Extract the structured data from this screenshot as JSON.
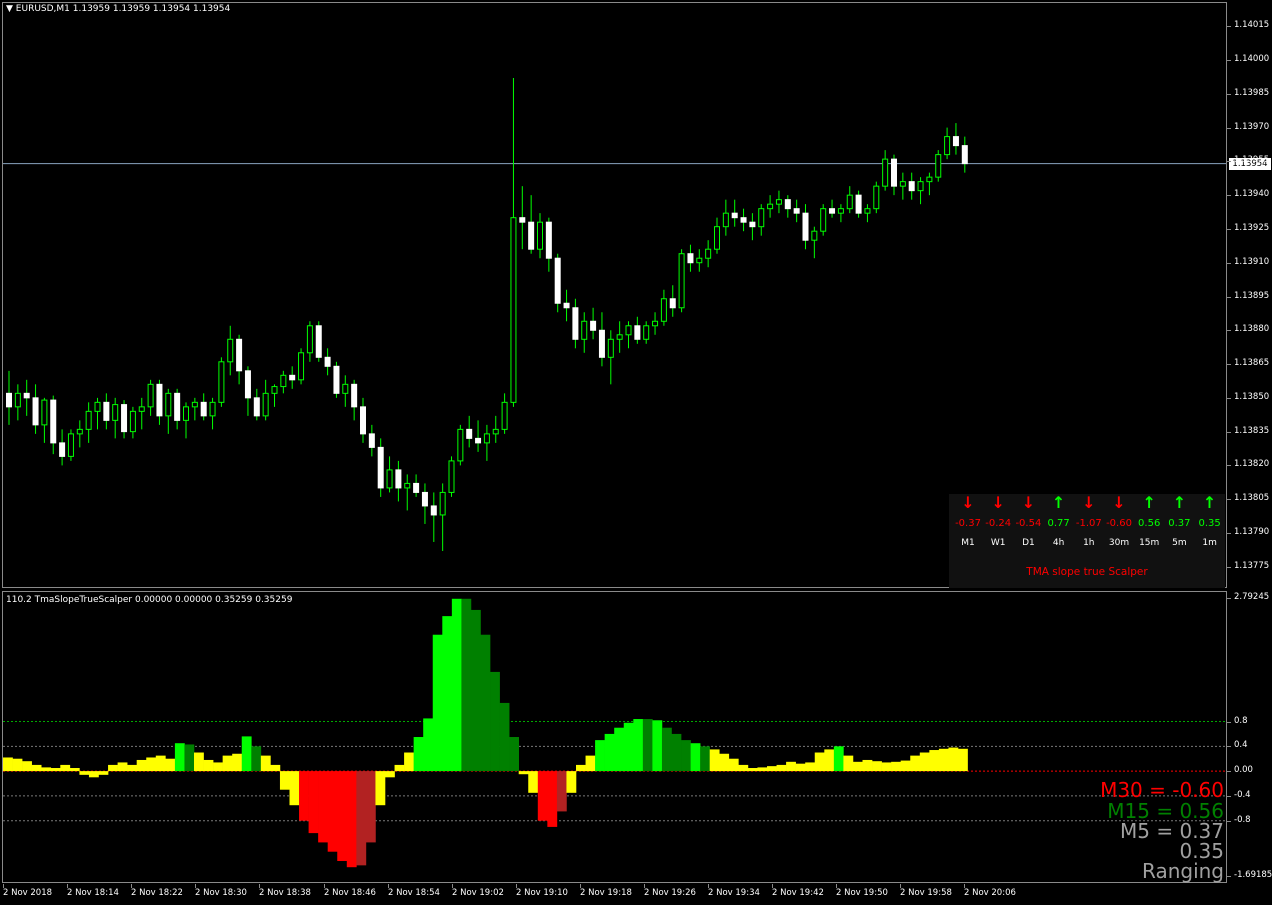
{
  "main_chart": {
    "title": "EURUSD,M1  1.13959 1.13959 1.13954 1.13954",
    "current_price": "1.13954",
    "price_ticks": [
      "1.14015",
      "1.14000",
      "1.13985",
      "1.13970",
      "1.13955",
      "1.13940",
      "1.13925",
      "1.13910",
      "1.13895",
      "1.13880",
      "1.13865",
      "1.13850",
      "1.13835",
      "1.13820",
      "1.13805",
      "1.13790",
      "1.13775"
    ]
  },
  "indicator": {
    "title": "110.2 TmaSlopeTrueScalper 0.00000 0.00000 0.35259 0.35259",
    "ticks": [
      "2.79245",
      "0.8",
      "0.4",
      "0.00",
      "-0.4",
      "-0.8",
      "-1.69185"
    ],
    "readouts": [
      {
        "text": "M30 = -0.60",
        "color": "#ff0000"
      },
      {
        "text": "M15 = 0.56",
        "color": "#008000"
      },
      {
        "text": "M5 = 0.37",
        "color": "#a0a0a0"
      },
      {
        "text": "0.35",
        "color": "#a0a0a0"
      },
      {
        "text": "Ranging",
        "color": "#a0a0a0"
      }
    ]
  },
  "tma_panel": {
    "title": "TMA slope true Scalper",
    "timeframes": [
      {
        "label": "M1",
        "value": "-0.37",
        "dir": "down"
      },
      {
        "label": "W1",
        "value": "-0.24",
        "dir": "down"
      },
      {
        "label": "D1",
        "value": "-0.54",
        "dir": "down"
      },
      {
        "label": "4h",
        "value": "0.77",
        "dir": "up"
      },
      {
        "label": "1h",
        "value": "-1.07",
        "dir": "down"
      },
      {
        "label": "30m",
        "value": "-0.60",
        "dir": "down"
      },
      {
        "label": "15m",
        "value": "0.56",
        "dir": "up"
      },
      {
        "label": "5m",
        "value": "0.37",
        "dir": "up"
      },
      {
        "label": "1m",
        "value": "0.35",
        "dir": "up"
      }
    ],
    "colors": {
      "up": "#00ff00",
      "down": "#ff0000"
    }
  },
  "time_axis": [
    "2 Nov 2018",
    "2 Nov 18:14",
    "2 Nov 18:22",
    "2 Nov 18:30",
    "2 Nov 18:38",
    "2 Nov 18:46",
    "2 Nov 18:54",
    "2 Nov 19:02",
    "2 Nov 19:10",
    "2 Nov 19:18",
    "2 Nov 19:26",
    "2 Nov 19:34",
    "2 Nov 19:42",
    "2 Nov 19:50",
    "2 Nov 19:58",
    "2 Nov 20:06"
  ],
  "chart_data": {
    "type": "candlestick+histogram",
    "candles_ohlc": [
      [
        1.13852,
        1.13862,
        1.13838,
        1.13846
      ],
      [
        1.13846,
        1.13856,
        1.1384,
        1.13852
      ],
      [
        1.13852,
        1.13858,
        1.13842,
        1.1385
      ],
      [
        1.1385,
        1.13856,
        1.13834,
        1.13838
      ],
      [
        1.13838,
        1.1385,
        1.1383,
        1.13849
      ],
      [
        1.13849,
        1.13851,
        1.13825,
        1.1383
      ],
      [
        1.1383,
        1.13836,
        1.1382,
        1.13824
      ],
      [
        1.13824,
        1.13836,
        1.13822,
        1.13834
      ],
      [
        1.13834,
        1.1384,
        1.13828,
        1.13836
      ],
      [
        1.13836,
        1.13848,
        1.1383,
        1.13844
      ],
      [
        1.13844,
        1.1385,
        1.13836,
        1.13848
      ],
      [
        1.13848,
        1.13852,
        1.13836,
        1.1384
      ],
      [
        1.1384,
        1.1385,
        1.13832,
        1.13847
      ],
      [
        1.13847,
        1.13849,
        1.13832,
        1.13835
      ],
      [
        1.13835,
        1.13846,
        1.13832,
        1.13844
      ],
      [
        1.13844,
        1.1385,
        1.13836,
        1.13846
      ],
      [
        1.13846,
        1.13858,
        1.13842,
        1.13856
      ],
      [
        1.13856,
        1.13858,
        1.13838,
        1.13842
      ],
      [
        1.13842,
        1.13854,
        1.13834,
        1.13852
      ],
      [
        1.13852,
        1.13854,
        1.13836,
        1.1384
      ],
      [
        1.1384,
        1.13848,
        1.13832,
        1.13846
      ],
      [
        1.13846,
        1.1385,
        1.1384,
        1.13848
      ],
      [
        1.13848,
        1.13852,
        1.1384,
        1.13842
      ],
      [
        1.13842,
        1.1385,
        1.13836,
        1.13848
      ],
      [
        1.13848,
        1.13868,
        1.13846,
        1.13866
      ],
      [
        1.13866,
        1.13882,
        1.1386,
        1.13876
      ],
      [
        1.13876,
        1.13878,
        1.13856,
        1.13862
      ],
      [
        1.13862,
        1.13864,
        1.13842,
        1.1385
      ],
      [
        1.1385,
        1.13854,
        1.1384,
        1.13842
      ],
      [
        1.13842,
        1.13858,
        1.1384,
        1.13852
      ],
      [
        1.13852,
        1.13856,
        1.13846,
        1.13855
      ],
      [
        1.13855,
        1.13862,
        1.13852,
        1.1386
      ],
      [
        1.1386,
        1.13864,
        1.13854,
        1.13858
      ],
      [
        1.13858,
        1.13872,
        1.13856,
        1.1387
      ],
      [
        1.1387,
        1.13884,
        1.13866,
        1.13882
      ],
      [
        1.13882,
        1.13884,
        1.13866,
        1.13868
      ],
      [
        1.13868,
        1.13872,
        1.1386,
        1.13864
      ],
      [
        1.13864,
        1.13866,
        1.1385,
        1.13852
      ],
      [
        1.13852,
        1.1386,
        1.13846,
        1.13856
      ],
      [
        1.13856,
        1.13858,
        1.1384,
        1.13846
      ],
      [
        1.13846,
        1.1385,
        1.1383,
        1.13834
      ],
      [
        1.13834,
        1.13838,
        1.13824,
        1.13828
      ],
      [
        1.13828,
        1.13832,
        1.13806,
        1.1381
      ],
      [
        1.1381,
        1.13824,
        1.13808,
        1.13818
      ],
      [
        1.13818,
        1.13822,
        1.13804,
        1.1381
      ],
      [
        1.1381,
        1.13816,
        1.138,
        1.13812
      ],
      [
        1.13812,
        1.13816,
        1.13806,
        1.13808
      ],
      [
        1.13808,
        1.13812,
        1.13794,
        1.13802
      ],
      [
        1.13802,
        1.13808,
        1.13786,
        1.13798
      ],
      [
        1.13798,
        1.13812,
        1.13782,
        1.13808
      ],
      [
        1.13808,
        1.13824,
        1.13806,
        1.13822
      ],
      [
        1.13822,
        1.13838,
        1.1382,
        1.13836
      ],
      [
        1.13836,
        1.13842,
        1.13828,
        1.13832
      ],
      [
        1.13832,
        1.1384,
        1.13826,
        1.1383
      ],
      [
        1.1383,
        1.13838,
        1.13822,
        1.13834
      ],
      [
        1.13834,
        1.13842,
        1.1383,
        1.13836
      ],
      [
        1.13836,
        1.13852,
        1.13834,
        1.13848
      ],
      [
        1.13848,
        1.13992,
        1.13846,
        1.1393
      ],
      [
        1.1393,
        1.13944,
        1.13916,
        1.13928
      ],
      [
        1.13928,
        1.1394,
        1.13914,
        1.13916
      ],
      [
        1.13916,
        1.13932,
        1.13912,
        1.13928
      ],
      [
        1.13928,
        1.1393,
        1.13906,
        1.13912
      ],
      [
        1.13912,
        1.13914,
        1.13888,
        1.13892
      ],
      [
        1.13892,
        1.13898,
        1.13884,
        1.1389
      ],
      [
        1.1389,
        1.13894,
        1.13872,
        1.13876
      ],
      [
        1.13876,
        1.13888,
        1.1387,
        1.13884
      ],
      [
        1.13884,
        1.1389,
        1.13876,
        1.1388
      ],
      [
        1.1388,
        1.13888,
        1.13864,
        1.13868
      ],
      [
        1.13868,
        1.1388,
        1.13856,
        1.13876
      ],
      [
        1.13876,
        1.13884,
        1.1387,
        1.13878
      ],
      [
        1.13878,
        1.13884,
        1.13872,
        1.13882
      ],
      [
        1.13882,
        1.13886,
        1.13874,
        1.13876
      ],
      [
        1.13876,
        1.13884,
        1.13874,
        1.13882
      ],
      [
        1.13882,
        1.13888,
        1.13878,
        1.13884
      ],
      [
        1.13884,
        1.13898,
        1.13882,
        1.13894
      ],
      [
        1.13894,
        1.139,
        1.13886,
        1.1389
      ],
      [
        1.1389,
        1.13916,
        1.13888,
        1.13914
      ],
      [
        1.13914,
        1.13918,
        1.13906,
        1.1391
      ],
      [
        1.1391,
        1.13916,
        1.13906,
        1.13912
      ],
      [
        1.13912,
        1.1392,
        1.13908,
        1.13916
      ],
      [
        1.13916,
        1.1393,
        1.13914,
        1.13926
      ],
      [
        1.13926,
        1.13938,
        1.13922,
        1.13932
      ],
      [
        1.13932,
        1.13938,
        1.13926,
        1.1393
      ],
      [
        1.1393,
        1.13934,
        1.13924,
        1.13928
      ],
      [
        1.13928,
        1.13932,
        1.1392,
        1.13926
      ],
      [
        1.13926,
        1.13936,
        1.13922,
        1.13934
      ],
      [
        1.13934,
        1.1394,
        1.1393,
        1.13936
      ],
      [
        1.13936,
        1.13942,
        1.13932,
        1.13938
      ],
      [
        1.13938,
        1.1394,
        1.1393,
        1.13934
      ],
      [
        1.13934,
        1.13938,
        1.13928,
        1.13932
      ],
      [
        1.13932,
        1.13936,
        1.13916,
        1.1392
      ],
      [
        1.1392,
        1.13926,
        1.13912,
        1.13924
      ],
      [
        1.13924,
        1.13936,
        1.13922,
        1.13934
      ],
      [
        1.13934,
        1.13938,
        1.1393,
        1.13932
      ],
      [
        1.13932,
        1.13936,
        1.13928,
        1.13934
      ],
      [
        1.13934,
        1.13944,
        1.13932,
        1.1394
      ],
      [
        1.1394,
        1.13942,
        1.1393,
        1.13932
      ],
      [
        1.13932,
        1.13936,
        1.13928,
        1.13934
      ],
      [
        1.13934,
        1.13946,
        1.13932,
        1.13944
      ],
      [
        1.13944,
        1.1396,
        1.13942,
        1.13956
      ],
      [
        1.13956,
        1.13958,
        1.1394,
        1.13944
      ],
      [
        1.13944,
        1.1395,
        1.13938,
        1.13946
      ],
      [
        1.13946,
        1.1395,
        1.13938,
        1.13942
      ],
      [
        1.13942,
        1.13948,
        1.13936,
        1.13946
      ],
      [
        1.13946,
        1.1395,
        1.1394,
        1.13948
      ],
      [
        1.13948,
        1.1396,
        1.13946,
        1.13958
      ],
      [
        1.13958,
        1.1397,
        1.13956,
        1.13966
      ],
      [
        1.13966,
        1.13972,
        1.13958,
        1.13962
      ],
      [
        1.13962,
        1.13966,
        1.1395,
        1.13954
      ]
    ],
    "histogram_bars": [
      {
        "v": 0.22,
        "c": "yellow"
      },
      {
        "v": 0.2,
        "c": "yellow"
      },
      {
        "v": 0.16,
        "c": "yellow"
      },
      {
        "v": 0.1,
        "c": "yellow"
      },
      {
        "v": 0.06,
        "c": "yellow"
      },
      {
        "v": 0.05,
        "c": "yellow"
      },
      {
        "v": 0.1,
        "c": "yellow"
      },
      {
        "v": 0.05,
        "c": "yellow"
      },
      {
        "v": -0.06,
        "c": "yellow"
      },
      {
        "v": -0.1,
        "c": "yellow"
      },
      {
        "v": -0.06,
        "c": "yellow"
      },
      {
        "v": 0.1,
        "c": "yellow"
      },
      {
        "v": 0.14,
        "c": "yellow"
      },
      {
        "v": 0.1,
        "c": "yellow"
      },
      {
        "v": 0.18,
        "c": "yellow"
      },
      {
        "v": 0.22,
        "c": "yellow"
      },
      {
        "v": 0.25,
        "c": "yellow"
      },
      {
        "v": 0.2,
        "c": "yellow"
      },
      {
        "v": 0.45,
        "c": "green"
      },
      {
        "v": 0.43,
        "c": "darkgreen"
      },
      {
        "v": 0.3,
        "c": "yellow"
      },
      {
        "v": 0.18,
        "c": "yellow"
      },
      {
        "v": 0.14,
        "c": "yellow"
      },
      {
        "v": 0.25,
        "c": "yellow"
      },
      {
        "v": 0.28,
        "c": "yellow"
      },
      {
        "v": 0.56,
        "c": "green"
      },
      {
        "v": 0.4,
        "c": "darkgreen"
      },
      {
        "v": 0.25,
        "c": "yellow"
      },
      {
        "v": 0.1,
        "c": "yellow"
      },
      {
        "v": -0.3,
        "c": "yellow"
      },
      {
        "v": -0.55,
        "c": "yellow"
      },
      {
        "v": -0.8,
        "c": "red"
      },
      {
        "v": -1.0,
        "c": "red"
      },
      {
        "v": -1.15,
        "c": "red"
      },
      {
        "v": -1.3,
        "c": "red"
      },
      {
        "v": -1.45,
        "c": "red"
      },
      {
        "v": -1.55,
        "c": "red"
      },
      {
        "v": -1.52,
        "c": "darkred"
      },
      {
        "v": -1.15,
        "c": "darkred"
      },
      {
        "v": -0.55,
        "c": "yellow"
      },
      {
        "v": -0.1,
        "c": "yellow"
      },
      {
        "v": 0.1,
        "c": "yellow"
      },
      {
        "v": 0.3,
        "c": "yellow"
      },
      {
        "v": 0.55,
        "c": "green"
      },
      {
        "v": 0.85,
        "c": "green"
      },
      {
        "v": 2.2,
        "c": "green"
      },
      {
        "v": 2.5,
        "c": "green"
      },
      {
        "v": 2.78,
        "c": "green"
      },
      {
        "v": 2.78,
        "c": "darkgreen"
      },
      {
        "v": 2.6,
        "c": "darkgreen"
      },
      {
        "v": 2.2,
        "c": "darkgreen"
      },
      {
        "v": 1.6,
        "c": "darkgreen"
      },
      {
        "v": 1.1,
        "c": "darkgreen"
      },
      {
        "v": 0.55,
        "c": "darkgreen"
      },
      {
        "v": -0.05,
        "c": "yellow"
      },
      {
        "v": -0.35,
        "c": "yellow"
      },
      {
        "v": -0.8,
        "c": "red"
      },
      {
        "v": -0.9,
        "c": "red"
      },
      {
        "v": -0.65,
        "c": "darkred"
      },
      {
        "v": -0.35,
        "c": "yellow"
      },
      {
        "v": 0.1,
        "c": "yellow"
      },
      {
        "v": 0.25,
        "c": "yellow"
      },
      {
        "v": 0.5,
        "c": "green"
      },
      {
        "v": 0.6,
        "c": "green"
      },
      {
        "v": 0.7,
        "c": "green"
      },
      {
        "v": 0.78,
        "c": "green"
      },
      {
        "v": 0.84,
        "c": "green"
      },
      {
        "v": 0.84,
        "c": "darkgreen"
      },
      {
        "v": 0.82,
        "c": "green"
      },
      {
        "v": 0.7,
        "c": "darkgreen"
      },
      {
        "v": 0.6,
        "c": "darkgreen"
      },
      {
        "v": 0.5,
        "c": "darkgreen"
      },
      {
        "v": 0.45,
        "c": "green"
      },
      {
        "v": 0.4,
        "c": "darkgreen"
      },
      {
        "v": 0.35,
        "c": "yellow"
      },
      {
        "v": 0.28,
        "c": "yellow"
      },
      {
        "v": 0.2,
        "c": "yellow"
      },
      {
        "v": 0.1,
        "c": "yellow"
      },
      {
        "v": 0.05,
        "c": "yellow"
      },
      {
        "v": 0.06,
        "c": "yellow"
      },
      {
        "v": 0.08,
        "c": "yellow"
      },
      {
        "v": 0.1,
        "c": "yellow"
      },
      {
        "v": 0.15,
        "c": "yellow"
      },
      {
        "v": 0.12,
        "c": "yellow"
      },
      {
        "v": 0.14,
        "c": "yellow"
      },
      {
        "v": 0.3,
        "c": "yellow"
      },
      {
        "v": 0.35,
        "c": "yellow"
      },
      {
        "v": 0.4,
        "c": "green"
      },
      {
        "v": 0.25,
        "c": "yellow"
      },
      {
        "v": 0.15,
        "c": "yellow"
      },
      {
        "v": 0.18,
        "c": "yellow"
      },
      {
        "v": 0.16,
        "c": "yellow"
      },
      {
        "v": 0.14,
        "c": "yellow"
      },
      {
        "v": 0.15,
        "c": "yellow"
      },
      {
        "v": 0.17,
        "c": "yellow"
      },
      {
        "v": 0.25,
        "c": "yellow"
      },
      {
        "v": 0.3,
        "c": "yellow"
      },
      {
        "v": 0.34,
        "c": "yellow"
      },
      {
        "v": 0.36,
        "c": "yellow"
      },
      {
        "v": 0.38,
        "c": "yellow"
      },
      {
        "v": 0.36,
        "c": "yellow"
      }
    ],
    "histogram_colors": {
      "yellow": "#ffff00",
      "green": "#00ff00",
      "darkgreen": "#008000",
      "red": "#ff0000",
      "darkred": "#b22222"
    },
    "levels": [
      0.8,
      0.4,
      0.0,
      -0.4,
      -0.8
    ],
    "ylim_price": [
      1.1377,
      1.1402
    ],
    "ylim_indicator": [
      -1.69185,
      2.79245
    ]
  }
}
